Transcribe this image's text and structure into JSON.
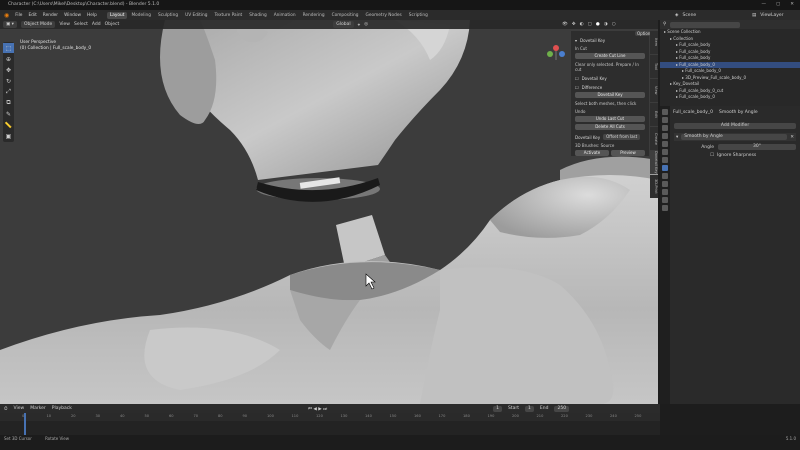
{
  "window": {
    "title": "Character (C:\\Users\\Mikel\\Desktop\\Character.blend) - Blender 5.1.0",
    "controls": [
      "—",
      "▢",
      "✕"
    ]
  },
  "menu": {
    "items": [
      "File",
      "Edit",
      "Render",
      "Window",
      "Help"
    ]
  },
  "workspaces": [
    "Layout",
    "Modeling",
    "Sculpting",
    "UV Editing",
    "Texture Paint",
    "Shading",
    "Animation",
    "Rendering",
    "Compositing",
    "Geometry Nodes",
    "Scripting"
  ],
  "active_workspace": "Layout",
  "scene": {
    "label": "Scene",
    "view_layer": "ViewLayer"
  },
  "viewport": {
    "mode": "Object Mode",
    "menus": [
      "View",
      "Select",
      "Add",
      "Object"
    ],
    "overlay_line1": "User Perspective",
    "overlay_line2": "(0) Collection | Full_scale_body_0",
    "transform": "Global"
  },
  "npanel": {
    "options": "Options",
    "sec1": "Dovetail Key",
    "cut_label": "In Cut",
    "cut_btn": "Create Cut Line",
    "cut_hint": "Clear only selected. Prepare / In cut",
    "sec2": "Dovetail Key",
    "sec2b": "Difference",
    "dovetail_btn": "Dovetail Key",
    "dovetail_hint": "Select both meshes, then click",
    "sec3": "Undo",
    "undo1": "Undo Last Cut",
    "undo2": "Delete All Cuts",
    "sec4": "Dovetail Key",
    "sec4b": "Offset from last",
    "sec5": "3D Brushes: Source",
    "btn_a": "Activate",
    "btn_b": "Preview",
    "tabs": [
      "Item",
      "Tool",
      "View",
      "Edit",
      "Create",
      "Dovetail Key",
      "3D-Print"
    ]
  },
  "outliner": {
    "rows": [
      "Scene Collection",
      "Collection",
      "Full_scale_body",
      "Full_scale_body",
      "Full_scale_body",
      "Full_scale_body_0",
      "Full_scale_body_0",
      "3D_Preview_Full_scale_body_0",
      "Key_Dovetail",
      "Full_scale_body_0_cut",
      "Full_scale_body_0"
    ],
    "selected_index": 5
  },
  "properties": {
    "object": "Full_scale_body_0",
    "modifier_tab": "Smooth by Angle",
    "add_modifier": "Add Modifier",
    "mod_name": "Smooth by Angle",
    "angle_label": "Angle",
    "angle_value": "30°",
    "ignore_label": "Ignore Sharpness"
  },
  "timeline": {
    "menus": [
      "View",
      "Marker",
      "Playback"
    ],
    "start_label": "Start",
    "start": "1",
    "end_label": "End",
    "end": "250",
    "frame": "1",
    "ticks": [
      "0",
      "10",
      "20",
      "30",
      "40",
      "50",
      "60",
      "70",
      "80",
      "90",
      "100",
      "110",
      "120",
      "130",
      "140",
      "150",
      "160",
      "170",
      "180",
      "190",
      "200",
      "210",
      "220",
      "230",
      "240",
      "250"
    ]
  },
  "status": {
    "left": "Set 3D Cursor",
    "middle": "Rotate View",
    "right": "5.1.0"
  },
  "colors": {
    "accent": "#4772b3",
    "viewport": "#3c3c3c",
    "mesh": "#bdbdbd"
  }
}
